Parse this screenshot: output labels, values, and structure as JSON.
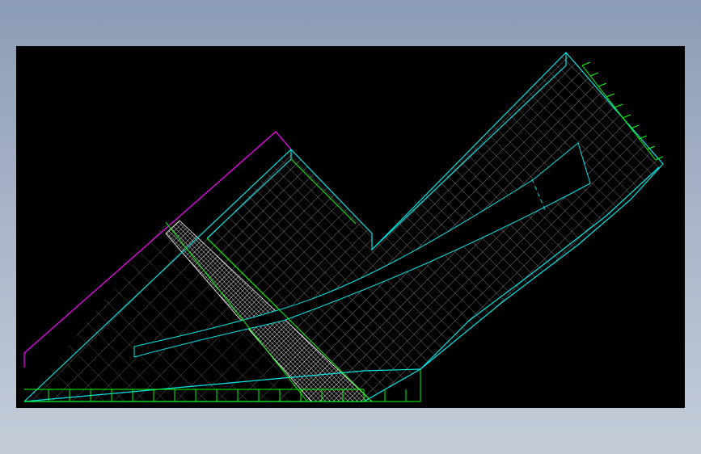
{
  "viewport": {
    "background": "#000000",
    "window_background_top": "#8b9cb6",
    "window_background_bottom": "#c4ccd9"
  },
  "mesh": {
    "element_type": "quadrilateral surface mesh (CFD)",
    "colors": {
      "boundary_edge": "#00e6e6",
      "coarse_grid": "#00ff00",
      "fine_grid": "#ffffff",
      "outer_wall": "#ff00ff",
      "dashed_interface": "#00e6e6"
    },
    "zones": [
      {
        "name": "inlet-left-domain",
        "kind": "coarse triangular-ish quad mesh"
      },
      {
        "name": "dense-band",
        "kind": "very fine white mesh strip"
      },
      {
        "name": "main-channel",
        "kind": "medium quad mesh"
      },
      {
        "name": "outlet-arm",
        "kind": "medium quad mesh with inner slot"
      },
      {
        "name": "bottom-boundary-layer",
        "kind": "green boundary-layer cells"
      }
    ]
  }
}
